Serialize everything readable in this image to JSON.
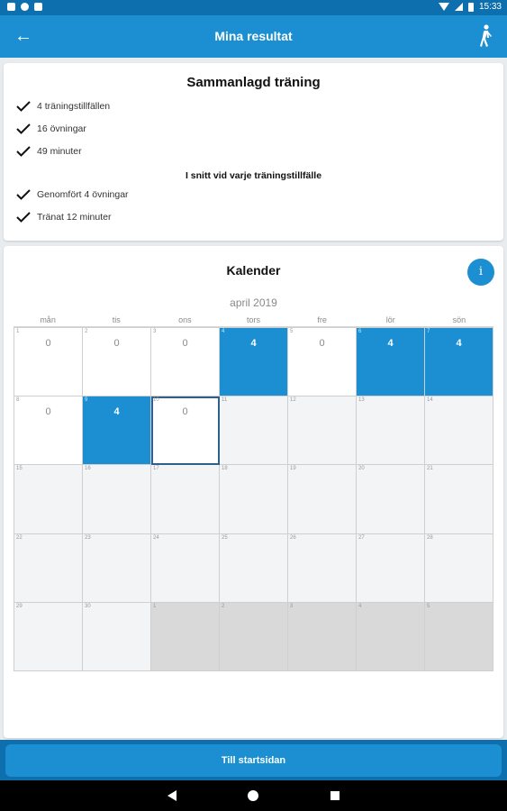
{
  "status_bar": {
    "time": "15:33"
  },
  "app_bar": {
    "title": "Mina resultat",
    "back_icon": "arrow-left-icon",
    "action_icon": "walking-person-icon"
  },
  "summary": {
    "title": "Sammanlagd träning",
    "totals": [
      "4 träningstillfällen",
      "16 övningar",
      "49 minuter"
    ],
    "average_title": "I snitt vid varje träningstillfälle",
    "averages": [
      "Genomfört 4 övningar",
      "Tränat 12 minuter"
    ]
  },
  "calendar": {
    "title": "Kalender",
    "info_label": "i",
    "month": "april 2019",
    "weekdays": [
      "mån",
      "tis",
      "ons",
      "tors",
      "fre",
      "lör",
      "sön"
    ],
    "cells": [
      {
        "day": "1",
        "count": "0",
        "state": "white"
      },
      {
        "day": "2",
        "count": "0",
        "state": "white"
      },
      {
        "day": "3",
        "count": "0",
        "state": "white"
      },
      {
        "day": "4",
        "count": "4",
        "state": "blue"
      },
      {
        "day": "5",
        "count": "0",
        "state": "white"
      },
      {
        "day": "6",
        "count": "4",
        "state": "blue"
      },
      {
        "day": "7",
        "count": "4",
        "state": "blue"
      },
      {
        "day": "8",
        "count": "0",
        "state": "white"
      },
      {
        "day": "9",
        "count": "4",
        "state": "blue"
      },
      {
        "day": "10",
        "count": "0",
        "state": "today"
      },
      {
        "day": "11",
        "count": "",
        "state": "future"
      },
      {
        "day": "12",
        "count": "",
        "state": "future"
      },
      {
        "day": "13",
        "count": "",
        "state": "future"
      },
      {
        "day": "14",
        "count": "",
        "state": "future"
      },
      {
        "day": "15",
        "count": "",
        "state": "future"
      },
      {
        "day": "16",
        "count": "",
        "state": "future"
      },
      {
        "day": "17",
        "count": "",
        "state": "future"
      },
      {
        "day": "18",
        "count": "",
        "state": "future"
      },
      {
        "day": "19",
        "count": "",
        "state": "future"
      },
      {
        "day": "20",
        "count": "",
        "state": "future"
      },
      {
        "day": "21",
        "count": "",
        "state": "future"
      },
      {
        "day": "22",
        "count": "",
        "state": "future"
      },
      {
        "day": "23",
        "count": "",
        "state": "future"
      },
      {
        "day": "24",
        "count": "",
        "state": "future"
      },
      {
        "day": "25",
        "count": "",
        "state": "future"
      },
      {
        "day": "26",
        "count": "",
        "state": "future"
      },
      {
        "day": "27",
        "count": "",
        "state": "future"
      },
      {
        "day": "28",
        "count": "",
        "state": "future"
      },
      {
        "day": "29",
        "count": "",
        "state": "future"
      },
      {
        "day": "30",
        "count": "",
        "state": "future"
      },
      {
        "day": "1",
        "count": "",
        "state": "other-month"
      },
      {
        "day": "2",
        "count": "",
        "state": "other-month"
      },
      {
        "day": "3",
        "count": "",
        "state": "other-month"
      },
      {
        "day": "4",
        "count": "",
        "state": "other-month"
      },
      {
        "day": "5",
        "count": "",
        "state": "other-month"
      }
    ]
  },
  "footer": {
    "button_label": "Till startsidan"
  },
  "colors": {
    "primary": "#1b8fd2",
    "dark": "#0e6fae",
    "other_month": "#d9d9d9"
  }
}
